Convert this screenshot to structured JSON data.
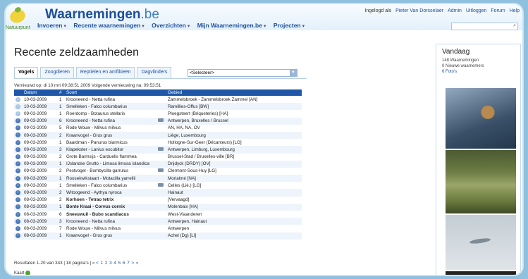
{
  "header": {
    "site_name": "Waarnemingen",
    "site_tld": ".be",
    "brand_sub": "Natuurpunt",
    "user_prefix": "Ingelogd als",
    "user_name": "Pieter Van Dorsselaer",
    "links": [
      "Admin",
      "Uitloggen",
      "Forum",
      "Help"
    ],
    "nav": [
      "Invoeren",
      "Recente waarnemingen",
      "Overzichten",
      "Mijn Waarnemingen.be",
      "Projecten"
    ]
  },
  "main": {
    "title": "Recente zeldzaamheden",
    "tabs": [
      "Vogels",
      "Zoogdieren",
      "Reptielen en amfibieën",
      "Dagvlinders"
    ],
    "select_value": "<Selecteer>",
    "refresh_text": "Vernieuwd op: di 10 mrt 09:38:51 2009 Volgende vernieuwing na: 09:53:51",
    "columns": [
      "Datum",
      "#",
      "Soort",
      "",
      "Gebied"
    ],
    "rows": [
      {
        "date": "10-03-2009",
        "n": "1",
        "species": "Krooneend - Netta rufina",
        "photo": false,
        "area": "Zammelsbroek - Zammelsbroek Zammel [AN]",
        "bold": false
      },
      {
        "date": "10-03-2009",
        "n": "1",
        "species": "Smelleken - Falco columbarius",
        "photo": false,
        "area": "Ramillies-Offus [BW]",
        "bold": false
      },
      {
        "date": "09-03-2009",
        "n": "1",
        "species": "Roerdomp - Botaurus stellaris",
        "photo": false,
        "area": "Ploegsteert (Briqueteries) [HA]",
        "bold": false
      },
      {
        "date": "09-03-2009",
        "n": "6",
        "species": "Krooneend - Netta rufina",
        "photo": true,
        "area": "Antwerpen, Bruxelles / Brussel",
        "bold": false
      },
      {
        "date": "09-03-2009",
        "n": "5",
        "species": "Rode Wouw - Milvus milvus",
        "photo": false,
        "area": "AN, HA, NA, OV",
        "bold": false
      },
      {
        "date": "09-03-2009",
        "n": "2",
        "species": "Kraanvogel - Grus grus",
        "photo": false,
        "area": "Liège, Luxembourg",
        "bold": false
      },
      {
        "date": "09-03-2009",
        "n": "1",
        "species": "Baardman - Panurus biarmicus",
        "photo": false,
        "area": "Hollogne-Sur-Geer (Décanteurs) [LG]",
        "bold": false
      },
      {
        "date": "09-03-2009",
        "n": "3",
        "species": "Klapekster - Lanius excubitor",
        "photo": true,
        "area": "Antwerpen, Limburg, Luxembourg",
        "bold": false
      },
      {
        "date": "09-03-2009",
        "n": "2",
        "species": "Grote Barmsijs - Carduelis flammea",
        "photo": false,
        "area": "Brussel-Stad / Bruxelles-ville [BR]",
        "bold": false
      },
      {
        "date": "09-03-2009",
        "n": "1",
        "species": "IJslandse Grutto - Limosa limosa islandica",
        "photo": false,
        "area": "Drijdyck (DRDY) [OV]",
        "bold": false
      },
      {
        "date": "09-03-2009",
        "n": "2",
        "species": "Pestvogel - Bombycilla garrulus",
        "photo": true,
        "area": "Clermont-Sous-Huy [LG]",
        "bold": false
      },
      {
        "date": "09-03-2009",
        "n": "1",
        "species": "Roosekwikstaart - Motacilla yarrellii",
        "photo": false,
        "area": "Morialmé [NA]",
        "bold": false
      },
      {
        "date": "09-03-2009",
        "n": "1",
        "species": "Smelleken - Falco columbarius",
        "photo": true,
        "area": "Celles (Lié.) [LG]",
        "bold": false
      },
      {
        "date": "09-03-2009",
        "n": "2",
        "species": "Witoogeend - Aythya nyroca",
        "photo": false,
        "area": "Hainaut",
        "bold": false
      },
      {
        "date": "08-03-2009",
        "n": "2",
        "species": "Korhoen - Tetrao tetrix",
        "photo": false,
        "area": "[Vervaagd]",
        "bold": true
      },
      {
        "date": "08-03-2009",
        "n": "1",
        "species": "Bonte Kraai - Corvus cornix",
        "photo": false,
        "area": "Molenbaix [HA]",
        "bold": true
      },
      {
        "date": "08-03-2009",
        "n": "6",
        "species": "Sneeuwuil - Bubo scandiacus",
        "photo": false,
        "area": "West-Vlaanderen",
        "bold": true
      },
      {
        "date": "08-03-2009",
        "n": "3",
        "species": "Krooneend - Netta rufina",
        "photo": false,
        "area": "Antwerpen, Hainaut",
        "bold": false
      },
      {
        "date": "08-03-2009",
        "n": "7",
        "species": "Rode Wouw - Milvus milvus",
        "photo": false,
        "area": "Antwerpen",
        "bold": false
      },
      {
        "date": "08-03-2009",
        "n": "1",
        "species": "Kraanvogel - Grus grus",
        "photo": false,
        "area": "Achel (Dg) [LI]",
        "bold": false
      }
    ],
    "pager_text": "Resultaten 1-20 van 343 | 18 pagina's | «",
    "pager_pages": [
      "<",
      "1",
      "2",
      "3",
      "4",
      "5",
      "6",
      "7",
      ">",
      "»"
    ],
    "footer": "Kaart"
  },
  "sidebar": {
    "title": "Vandaag",
    "line1": "148 Waarnemingen",
    "line2": "0 Nieuwe waarnemers",
    "line3": "6 Foto's"
  }
}
